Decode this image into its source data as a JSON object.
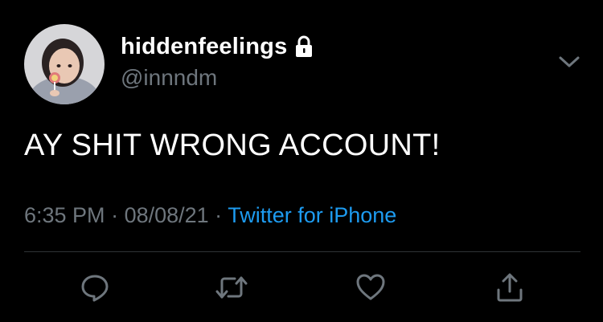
{
  "tweet": {
    "author": {
      "display_name": "hiddenfeelings",
      "handle": "@innndm",
      "protected_icon": "lock-icon"
    },
    "text": "AY SHIT WRONG ACCOUNT!",
    "time": "6:35 PM",
    "date": "08/08/21",
    "separator": " · ",
    "source": "Twitter for iPhone",
    "actions": [
      "reply-icon",
      "retweet-icon",
      "like-icon",
      "share-icon"
    ]
  },
  "colors": {
    "background": "#000000",
    "primary_text": "#ffffff",
    "secondary_text": "#6e767d",
    "link": "#1d9bf0",
    "divider": "#2f3336"
  }
}
